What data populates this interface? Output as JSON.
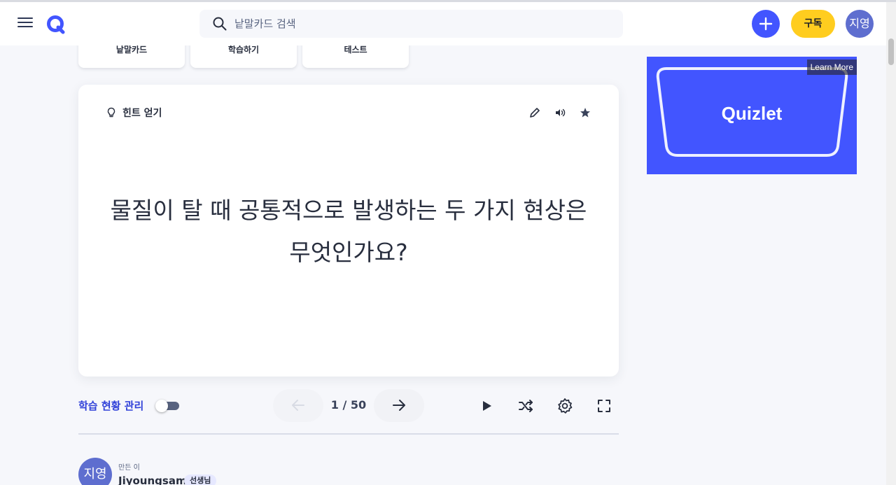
{
  "header": {
    "search_placeholder": "낱말카드 검색",
    "subscribe_label": "구독",
    "avatar_text": "지영"
  },
  "mode_tabs": [
    {
      "label": "낱말카드"
    },
    {
      "label": "학습하기"
    },
    {
      "label": "테스트"
    }
  ],
  "card": {
    "hint_label": "힌트 얻기",
    "term_text": "물질이 탈 때 공통적으로 발생하는 두 가지 현상은 무엇인가요?"
  },
  "controls": {
    "track_progress_label": "학습 현황 관리",
    "counter": "1 / 50",
    "toggle_on": false
  },
  "creator": {
    "made_by_label": "만든 이",
    "avatar_text": "지영",
    "name": "Jiyoungsam",
    "badge": "선생님"
  },
  "ad": {
    "learn_more": "Learn More",
    "brand": "Quizlet"
  },
  "colors": {
    "accent": "#4255ff",
    "subscribe": "#ffcd1f",
    "link": "#3041d9",
    "avatar": "#5e6ecf"
  },
  "icons": [
    "menu-icon",
    "quizlet-logo-icon",
    "search-icon",
    "plus-icon",
    "lightbulb-icon",
    "pencil-icon",
    "speaker-icon",
    "star-icon",
    "arrow-left-icon",
    "arrow-right-icon",
    "play-icon",
    "shuffle-icon",
    "settings-icon",
    "fullscreen-icon"
  ]
}
